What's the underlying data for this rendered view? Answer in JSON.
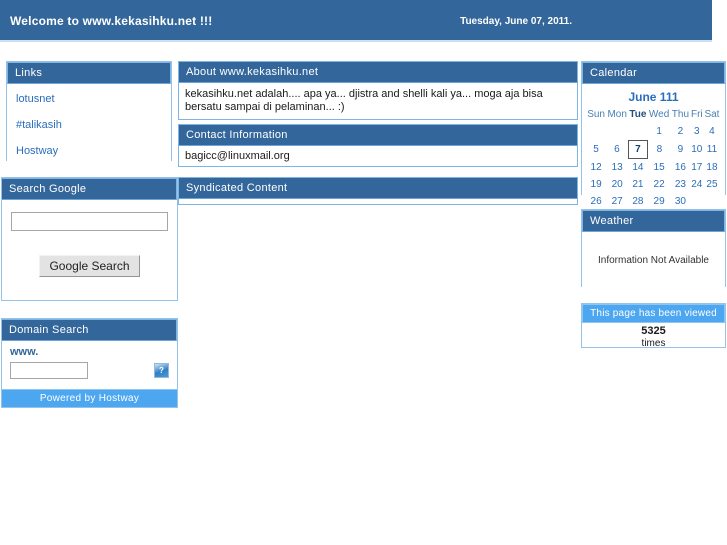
{
  "banner": {
    "title": "Welcome to www.kekasihku.net !!!",
    "date": "Tuesday, June 07, 2011.",
    "bg_color": "#33669a"
  },
  "links_panel": {
    "header": "Links",
    "items": [
      {
        "label": "lotusnet"
      },
      {
        "label": "#talikasih"
      },
      {
        "label": "Hostway"
      }
    ]
  },
  "search_google_panel": {
    "header": "Search Google",
    "input_value": "",
    "input_placeholder": "",
    "button_label": "Google Search"
  },
  "domain_search_panel": {
    "header": "Domain Search",
    "www_label": "www.",
    "input_value": "",
    "input_placeholder": "",
    "go_icon": "broken-image-icon",
    "go_icon_glyph": "?",
    "footer": "Powered by Hostway",
    "footer_color": "#4da6f0"
  },
  "about_panel": {
    "header": "About www.kekasihku.net",
    "body": "kekasihku.net adalah.... apa ya... djistra and shelli kali ya... moga aja bisa bersatu sampai di pelaminan... :)"
  },
  "contact_panel": {
    "header": "Contact Information",
    "body": "bagicc@linuxmail.org"
  },
  "syndicated_panel": {
    "header": "Syndicated Content",
    "body": ""
  },
  "calendar_panel": {
    "header": "Calendar",
    "title": "June 111",
    "weekdays": [
      "Sun",
      "Mon",
      "Tue",
      "Wed",
      "Thu",
      "Fri",
      "Sat"
    ],
    "today_weekday_index": 2,
    "today": 7,
    "weeks": [
      [
        "",
        "",
        "",
        "1",
        "2",
        "3",
        "4"
      ],
      [
        "5",
        "6",
        "7",
        "8",
        "9",
        "10",
        "11"
      ],
      [
        "12",
        "13",
        "14",
        "15",
        "16",
        "17",
        "18"
      ],
      [
        "19",
        "20",
        "21",
        "22",
        "23",
        "24",
        "25"
      ],
      [
        "26",
        "27",
        "28",
        "29",
        "30",
        "",
        ""
      ]
    ],
    "accent_color": "#2a6ebb"
  },
  "weather_panel": {
    "header": "Weather",
    "message": "Information Not Available"
  },
  "counter_panel": {
    "header": "This page has been viewed",
    "count": "5325",
    "label": "times"
  }
}
